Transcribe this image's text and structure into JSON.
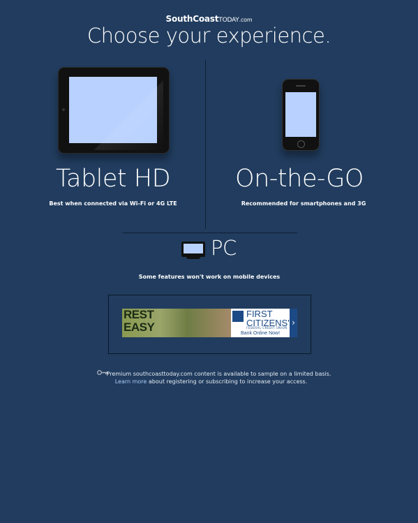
{
  "brand": {
    "main": "SouthCoast",
    "today": "TODAY",
    "suffix": ".com"
  },
  "headline": "Choose your experience.",
  "options": {
    "tablet": {
      "title": "Tablet HD",
      "caption": "Best when connected via Wi-Fi or 4G LTE"
    },
    "phone": {
      "title": "On-the-GO",
      "caption": "Recommended for smartphones and 3G"
    },
    "pc": {
      "title": "PC",
      "caption": "Some features won't work on mobile devices"
    }
  },
  "ad": {
    "headline_line1": "REST",
    "headline_line2": "EASY",
    "brand_line1": "FIRST",
    "brand_line2": "CITIZENS'",
    "brand_sub": "FEDERAL CREDIT UNION",
    "cta": "Bank Online Now!",
    "arrow": "›"
  },
  "notice": {
    "line1": "Premium southcoasttoday.com content is available to sample on a limited basis.",
    "link": "Learn more",
    "line2_rest": " about registering or subscribing to increase your access."
  },
  "colors": {
    "background": "#213c5e",
    "device_screen": "#b8d1ff",
    "link": "#a9c9f5"
  }
}
